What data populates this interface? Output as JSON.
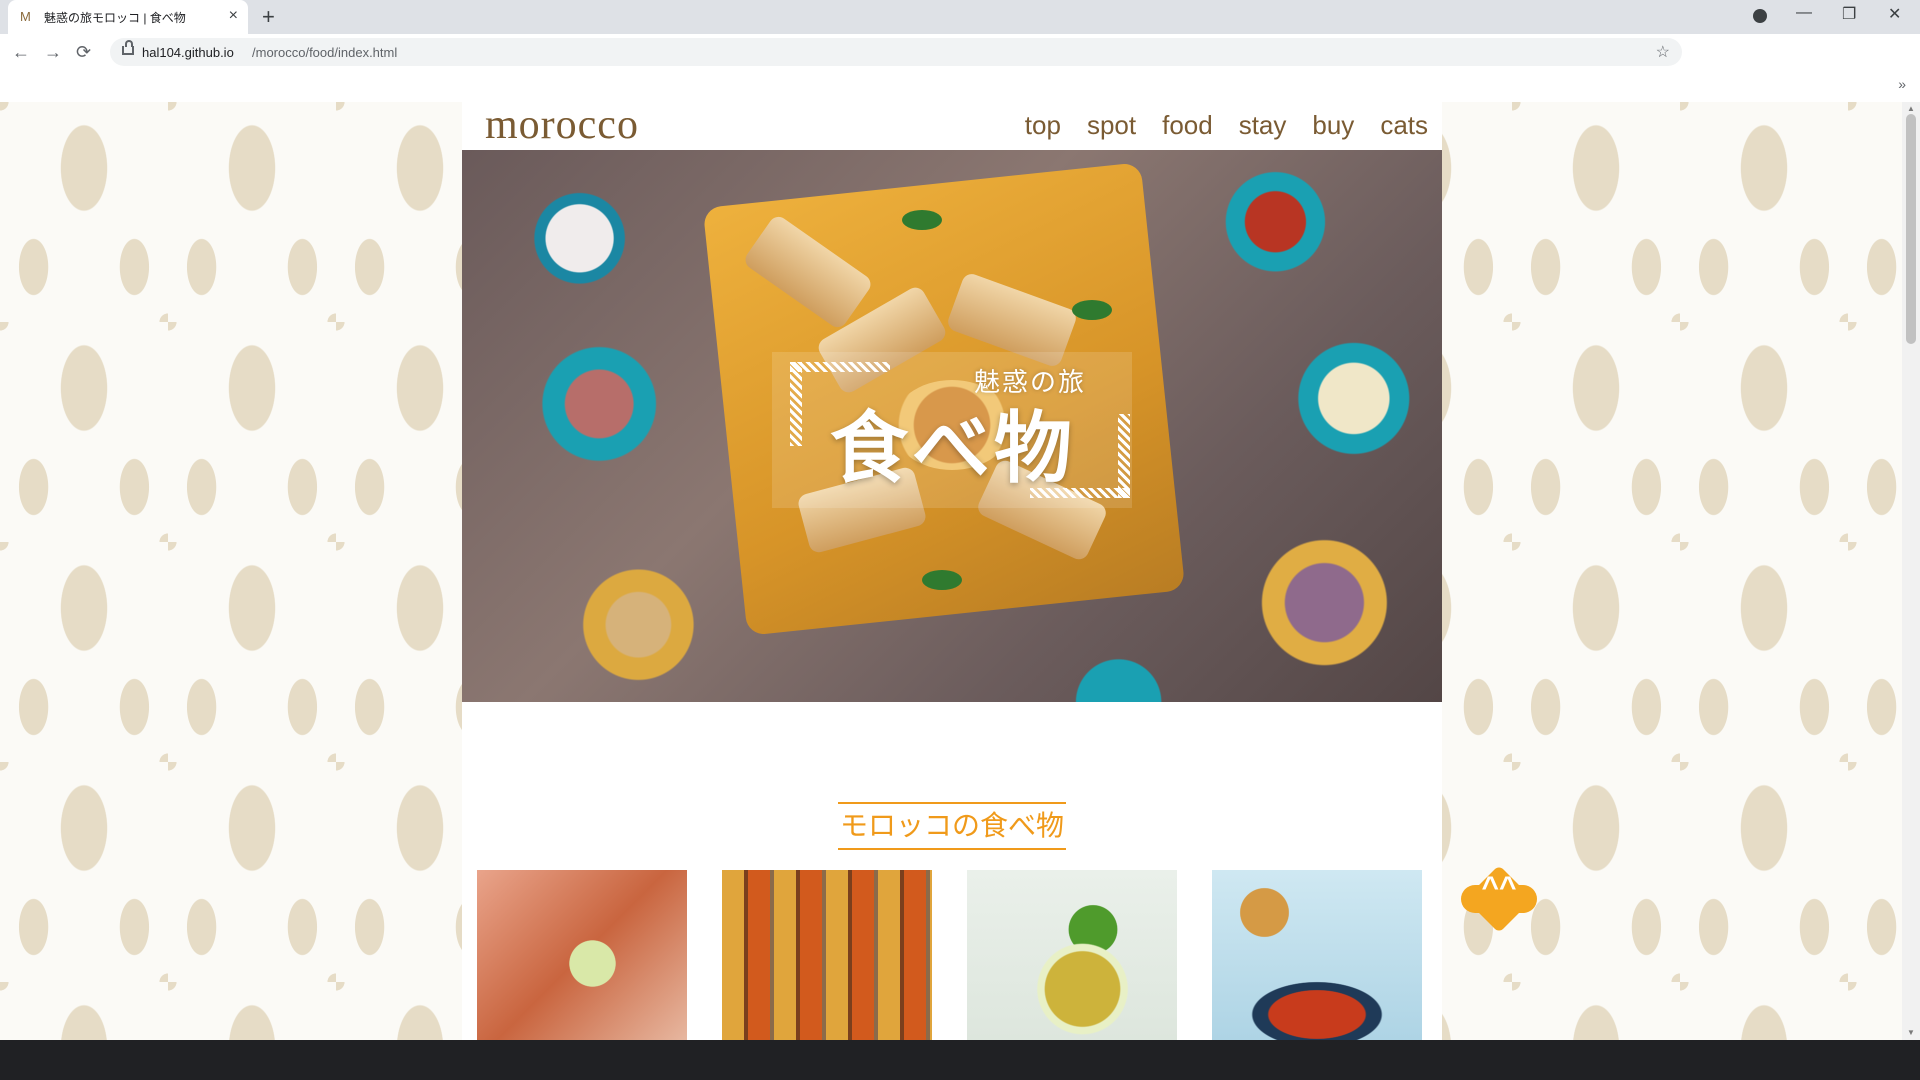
{
  "browser": {
    "tab_title": "魅惑の旅モロッコ | 食べ物",
    "tab_favicon": "M",
    "new_tab_label": "+",
    "close_tab_label": "×",
    "url_host": "hal104.github.io",
    "url_path": "/morocco/food/index.html",
    "back_icon": "←",
    "forward_icon": "→",
    "reload_icon": "⟳",
    "star_icon": "☆",
    "bookmarks_more": "»",
    "minimize_label": "—",
    "restore_label": "❐",
    "close_window_label": "✕"
  },
  "site": {
    "logo": "morocco",
    "nav": [
      "top",
      "spot",
      "food",
      "stay",
      "buy",
      "cats"
    ]
  },
  "hero": {
    "subtitle": "魅惑の旅",
    "title": "食べ物"
  },
  "section": {
    "title": "モロッコの食べ物"
  },
  "back_to_top": {
    "icon": "double-chevron-up-icon",
    "label": "^^"
  },
  "colors": {
    "accent": "#f09a1a",
    "logo_brown": "#7a5b33",
    "pattern": "#e6dcc6"
  }
}
